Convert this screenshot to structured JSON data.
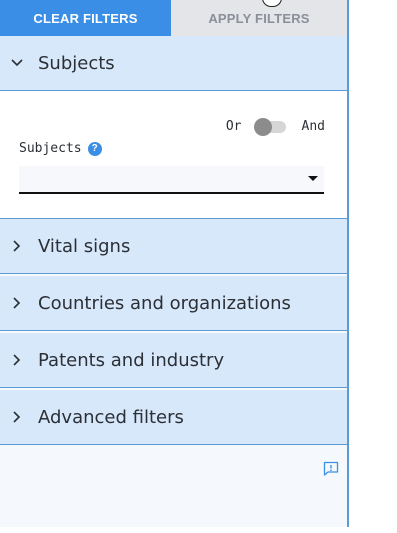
{
  "toolbar": {
    "clear_label": "CLEAR FILTERS",
    "apply_label": "APPLY FILTERS"
  },
  "sections": [
    {
      "label": "Subjects",
      "expanded": true
    },
    {
      "label": "Vital signs",
      "expanded": false
    },
    {
      "label": "Countries and organizations",
      "expanded": false
    },
    {
      "label": "Patents and industry",
      "expanded": false
    },
    {
      "label": "Advanced filters",
      "expanded": false
    }
  ],
  "subjects_panel": {
    "toggle_left": "Or",
    "toggle_right": "And",
    "toggle_state": "Or",
    "field_label": "Subjects",
    "help_symbol": "?",
    "selected_value": ""
  },
  "icons": {
    "expanded": "chevron-down-icon",
    "collapsed": "chevron-right-icon",
    "help": "help-icon",
    "dropdown": "dropdown-arrow-icon",
    "feedback": "feedback-icon"
  },
  "colors": {
    "accent": "#3b8ee6",
    "section_bg": "#d8e8fb",
    "border": "#5b9bd8",
    "disabled_button": "#e3e5e9"
  }
}
